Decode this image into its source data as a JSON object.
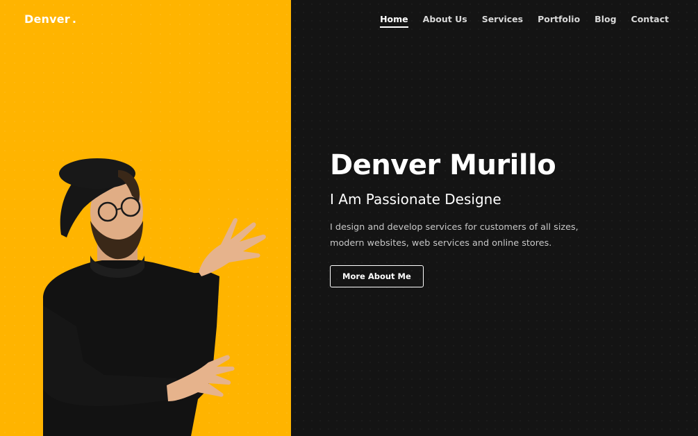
{
  "site": {
    "logo": "Denver",
    "logo_dot": "."
  },
  "nav": {
    "items": [
      {
        "label": "Home",
        "active": true
      },
      {
        "label": "About Us",
        "active": false
      },
      {
        "label": "Services",
        "active": false
      },
      {
        "label": "Portfolio",
        "active": false
      },
      {
        "label": "Blog",
        "active": false
      },
      {
        "label": "Contact",
        "active": false
      }
    ]
  },
  "hero": {
    "name": "Denver Murillo",
    "tagline": "I Am Passionate Designe",
    "description": "I design and develop services for customers of all sizes, modern websites, web services and online stores.",
    "cta_label": "More About Me"
  },
  "colors": {
    "accent": "#FFB400",
    "background": "#141414",
    "text": "#FFFFFF"
  }
}
